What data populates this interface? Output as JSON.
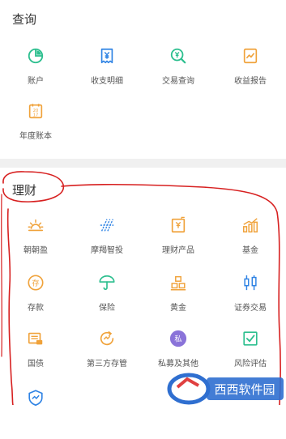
{
  "query": {
    "title": "查询",
    "items": [
      {
        "label": "账户",
        "icon": "pie-chart-icon"
      },
      {
        "label": "收支明细",
        "icon": "yen-document-icon"
      },
      {
        "label": "交易查询",
        "icon": "yen-search-icon"
      },
      {
        "label": "收益报告",
        "icon": "trend-report-icon"
      },
      {
        "label": "年度账本",
        "icon": "calendar-2017-icon",
        "icon_text": "20\n17"
      }
    ]
  },
  "finance": {
    "title": "理财",
    "items": [
      {
        "label": "朝朝盈",
        "icon": "sunrise-icon"
      },
      {
        "label": "摩羯智投",
        "icon": "capricorn-icon"
      },
      {
        "label": "理财产品",
        "icon": "product-icon"
      },
      {
        "label": "基金",
        "icon": "bar-trend-icon"
      },
      {
        "label": "存款",
        "icon": "deposit-icon",
        "icon_text": "存"
      },
      {
        "label": "保险",
        "icon": "umbrella-icon"
      },
      {
        "label": "黄金",
        "icon": "gold-bars-icon"
      },
      {
        "label": "证券交易",
        "icon": "candlestick-icon"
      },
      {
        "label": "国债",
        "icon": "bond-icon"
      },
      {
        "label": "第三方存管",
        "icon": "custody-icon"
      },
      {
        "label": "私募及其他",
        "icon": "private-equity-icon",
        "icon_text": "私"
      },
      {
        "label": "风险评估",
        "icon": "risk-check-icon"
      },
      {
        "label": "",
        "icon": "shield-chart-icon"
      }
    ]
  },
  "colors": {
    "green": "#2dbf8f",
    "blue": "#2f83e4",
    "orange": "#f0a23a",
    "purple": "#8a73d9",
    "annotation": "#d72020"
  },
  "watermark": {
    "brand": "西西软件园"
  }
}
